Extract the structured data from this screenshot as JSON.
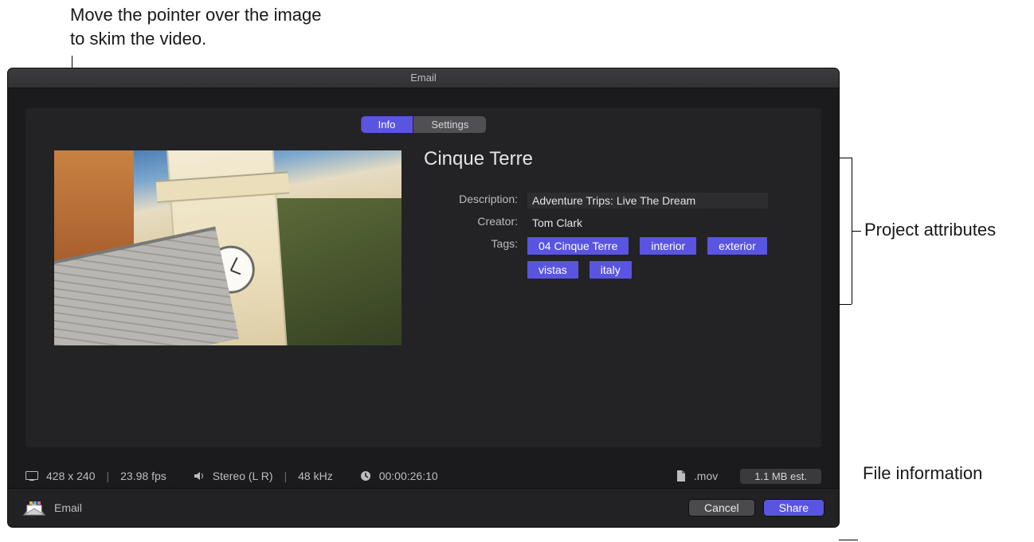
{
  "callouts": {
    "skim": "Move the pointer over the image to skim the video.",
    "attributes": "Project attributes",
    "fileinfo": "File information"
  },
  "window": {
    "title": "Email"
  },
  "tabs": {
    "info": "Info",
    "settings": "Settings"
  },
  "project": {
    "title": "Cinque Terre",
    "labels": {
      "description": "Description:",
      "creator": "Creator:",
      "tags": "Tags:"
    },
    "description": "Adventure Trips: Live The Dream",
    "creator": "Tom Clark",
    "tags": [
      "04 Cinque Terre",
      "interior",
      "exterior",
      "vistas",
      "italy"
    ]
  },
  "fileinfo": {
    "resolution": "428 x 240",
    "fps": "23.98 fps",
    "audio": "Stereo (L R)",
    "samplerate": "48 kHz",
    "duration": "00:00:26:10",
    "ext": ".mov",
    "size": "1.1 MB est."
  },
  "footer": {
    "destination": "Email",
    "cancel": "Cancel",
    "share": "Share"
  }
}
